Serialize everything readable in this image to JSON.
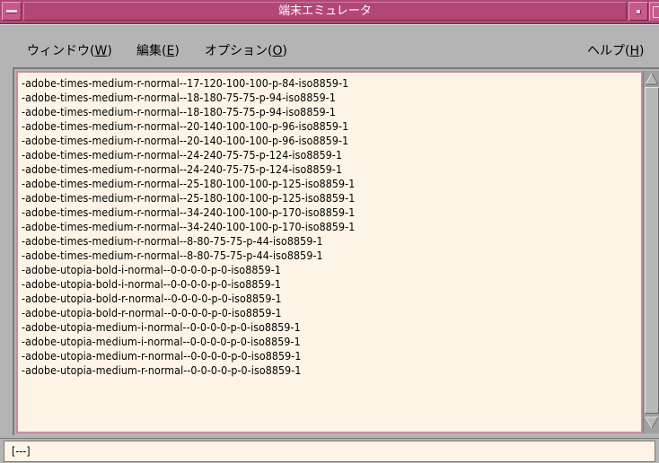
{
  "window": {
    "title": "端末エミュレータ"
  },
  "menubar": {
    "items": [
      {
        "label": "ウィンドウ(",
        "mnemonic": "W",
        "suffix": ")"
      },
      {
        "label": "編集(",
        "mnemonic": "E",
        "suffix": ")"
      },
      {
        "label": "オプション(",
        "mnemonic": "O",
        "suffix": ")"
      }
    ],
    "help": {
      "label": "ヘルプ(",
      "mnemonic": "H",
      "suffix": ")"
    }
  },
  "terminal": {
    "lines": [
      "-adobe-times-medium-r-normal--17-120-100-100-p-84-iso8859-1",
      "-adobe-times-medium-r-normal--18-180-75-75-p-94-iso8859-1",
      "-adobe-times-medium-r-normal--18-180-75-75-p-94-iso8859-1",
      "-adobe-times-medium-r-normal--20-140-100-100-p-96-iso8859-1",
      "-adobe-times-medium-r-normal--20-140-100-100-p-96-iso8859-1",
      "-adobe-times-medium-r-normal--24-240-75-75-p-124-iso8859-1",
      "-adobe-times-medium-r-normal--24-240-75-75-p-124-iso8859-1",
      "-adobe-times-medium-r-normal--25-180-100-100-p-125-iso8859-1",
      "-adobe-times-medium-r-normal--25-180-100-100-p-125-iso8859-1",
      "-adobe-times-medium-r-normal--34-240-100-100-p-170-iso8859-1",
      "-adobe-times-medium-r-normal--34-240-100-100-p-170-iso8859-1",
      "-adobe-times-medium-r-normal--8-80-75-75-p-44-iso8859-1",
      "-adobe-times-medium-r-normal--8-80-75-75-p-44-iso8859-1",
      "-adobe-utopia-bold-i-normal--0-0-0-0-p-0-iso8859-1",
      "-adobe-utopia-bold-i-normal--0-0-0-0-p-0-iso8859-1",
      "-adobe-utopia-bold-r-normal--0-0-0-0-p-0-iso8859-1",
      "-adobe-utopia-bold-r-normal--0-0-0-0-p-0-iso8859-1",
      "-adobe-utopia-medium-i-normal--0-0-0-0-p-0-iso8859-1",
      "-adobe-utopia-medium-i-normal--0-0-0-0-p-0-iso8859-1",
      "-adobe-utopia-medium-r-normal--0-0-0-0-p-0-iso8859-1",
      "-adobe-utopia-medium-r-normal--0-0-0-0-p-0-iso8859-1"
    ]
  },
  "status": {
    "text": "[---]"
  },
  "icons": {
    "window_menu": "window-menu-icon",
    "minimize": "minimize-icon",
    "maximize": "maximize-icon",
    "scroll_up": "arrow-up-icon",
    "scroll_down": "arrow-down-icon"
  }
}
